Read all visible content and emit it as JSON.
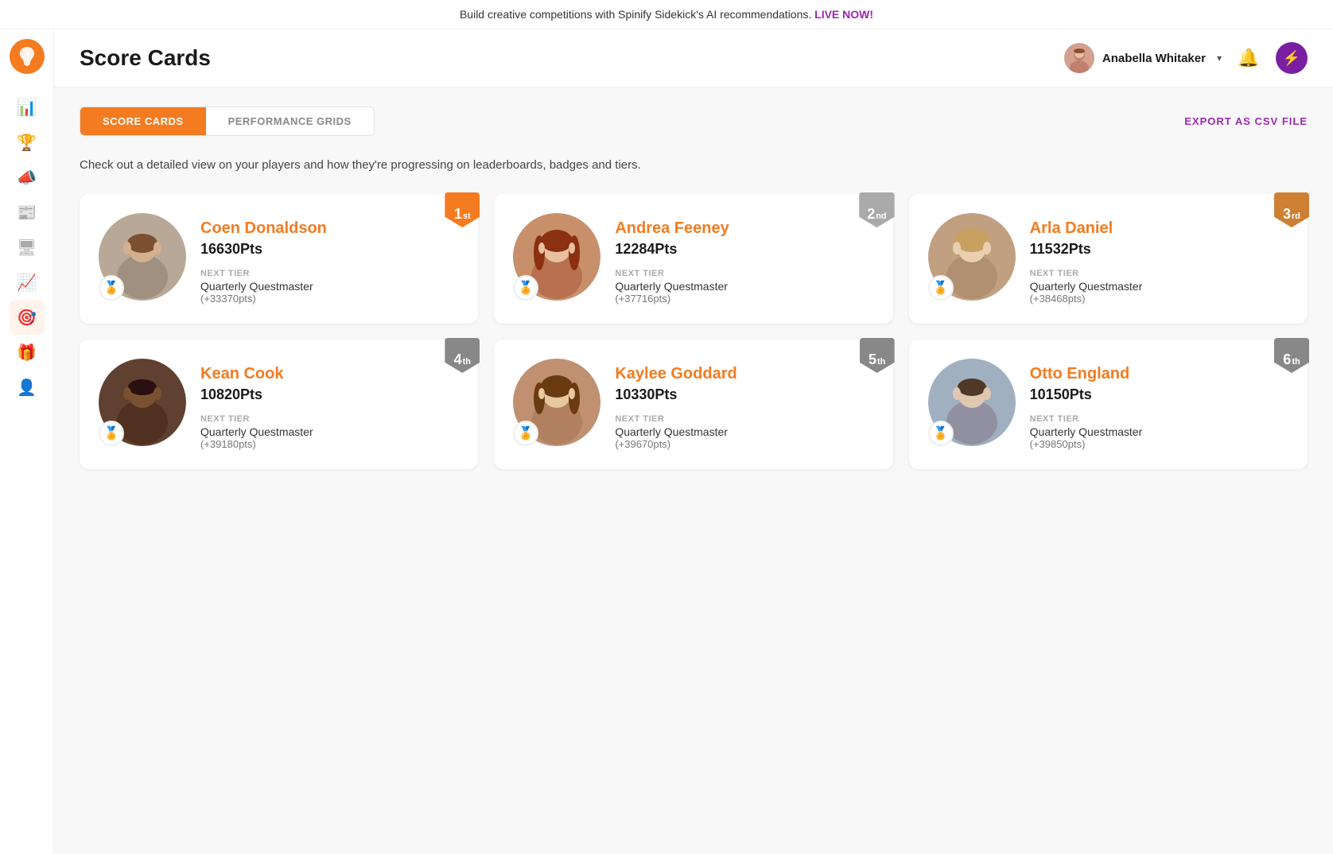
{
  "announcement": {
    "text": "Build creative competitions with Spinify Sidekick's AI recommendations.",
    "cta": "LIVE NOW!"
  },
  "header": {
    "title": "Score Cards",
    "user": {
      "name": "Anabella Whitaker"
    }
  },
  "tabs": [
    {
      "id": "score-cards",
      "label": "SCORE CARDS",
      "active": true
    },
    {
      "id": "performance-grids",
      "label": "PERFORMANCE GRIDS",
      "active": false
    }
  ],
  "export_btn": "EXPORT AS CSV FILE",
  "description": "Check out a detailed view on your players and how they're progressing on leaderboards, badges and tiers.",
  "players": [
    {
      "rank": "1",
      "rank_suffix": "st",
      "rank_class": "gold",
      "name": "Coen Donaldson",
      "pts": "16630Pts",
      "next_tier_label": "NEXT TIER",
      "next_tier_name": "Quarterly Questmaster",
      "next_tier_pts": "(+33370pts)"
    },
    {
      "rank": "2",
      "rank_suffix": "nd",
      "rank_class": "silver",
      "name": "Andrea Feeney",
      "pts": "12284Pts",
      "next_tier_label": "NEXT TIER",
      "next_tier_name": "Quarterly Questmaster",
      "next_tier_pts": "(+37716pts)"
    },
    {
      "rank": "3",
      "rank_suffix": "rd",
      "rank_class": "bronze",
      "name": "Arla Daniel",
      "pts": "11532Pts",
      "next_tier_label": "NEXT TIER",
      "next_tier_name": "Quarterly Questmaster",
      "next_tier_pts": "(+38468pts)"
    },
    {
      "rank": "4",
      "rank_suffix": "th",
      "rank_class": "rank4",
      "name": "Kean Cook",
      "pts": "10820Pts",
      "next_tier_label": "NEXT TIER",
      "next_tier_name": "Quarterly Questmaster",
      "next_tier_pts": "(+39180pts)"
    },
    {
      "rank": "5",
      "rank_suffix": "th",
      "rank_class": "rank5",
      "name": "Kaylee Goddard",
      "pts": "10330Pts",
      "next_tier_label": "NEXT TIER",
      "next_tier_name": "Quarterly Questmaster",
      "next_tier_pts": "(+39670pts)"
    },
    {
      "rank": "6",
      "rank_suffix": "th",
      "rank_class": "rank6",
      "name": "Otto England",
      "pts": "10150Pts",
      "next_tier_label": "NEXT TIER",
      "next_tier_name": "Quarterly Questmaster",
      "next_tier_pts": "(+39850pts)"
    }
  ],
  "sidebar": {
    "items": [
      {
        "id": "chart-bar",
        "icon": "📊",
        "label": "Analytics"
      },
      {
        "id": "trophy",
        "icon": "🏆",
        "label": "Leaderboards"
      },
      {
        "id": "megaphone",
        "icon": "📣",
        "label": "Competitions"
      },
      {
        "id": "news",
        "icon": "📰",
        "label": "News Feed"
      },
      {
        "id": "tv",
        "icon": "🖥",
        "label": "TV"
      },
      {
        "id": "trend",
        "icon": "📈",
        "label": "Trends"
      },
      {
        "id": "scorecards",
        "icon": "🎯",
        "label": "Score Cards",
        "active": true
      },
      {
        "id": "gift",
        "icon": "🎁",
        "label": "Rewards"
      },
      {
        "id": "users",
        "icon": "👤",
        "label": "Users"
      }
    ]
  }
}
